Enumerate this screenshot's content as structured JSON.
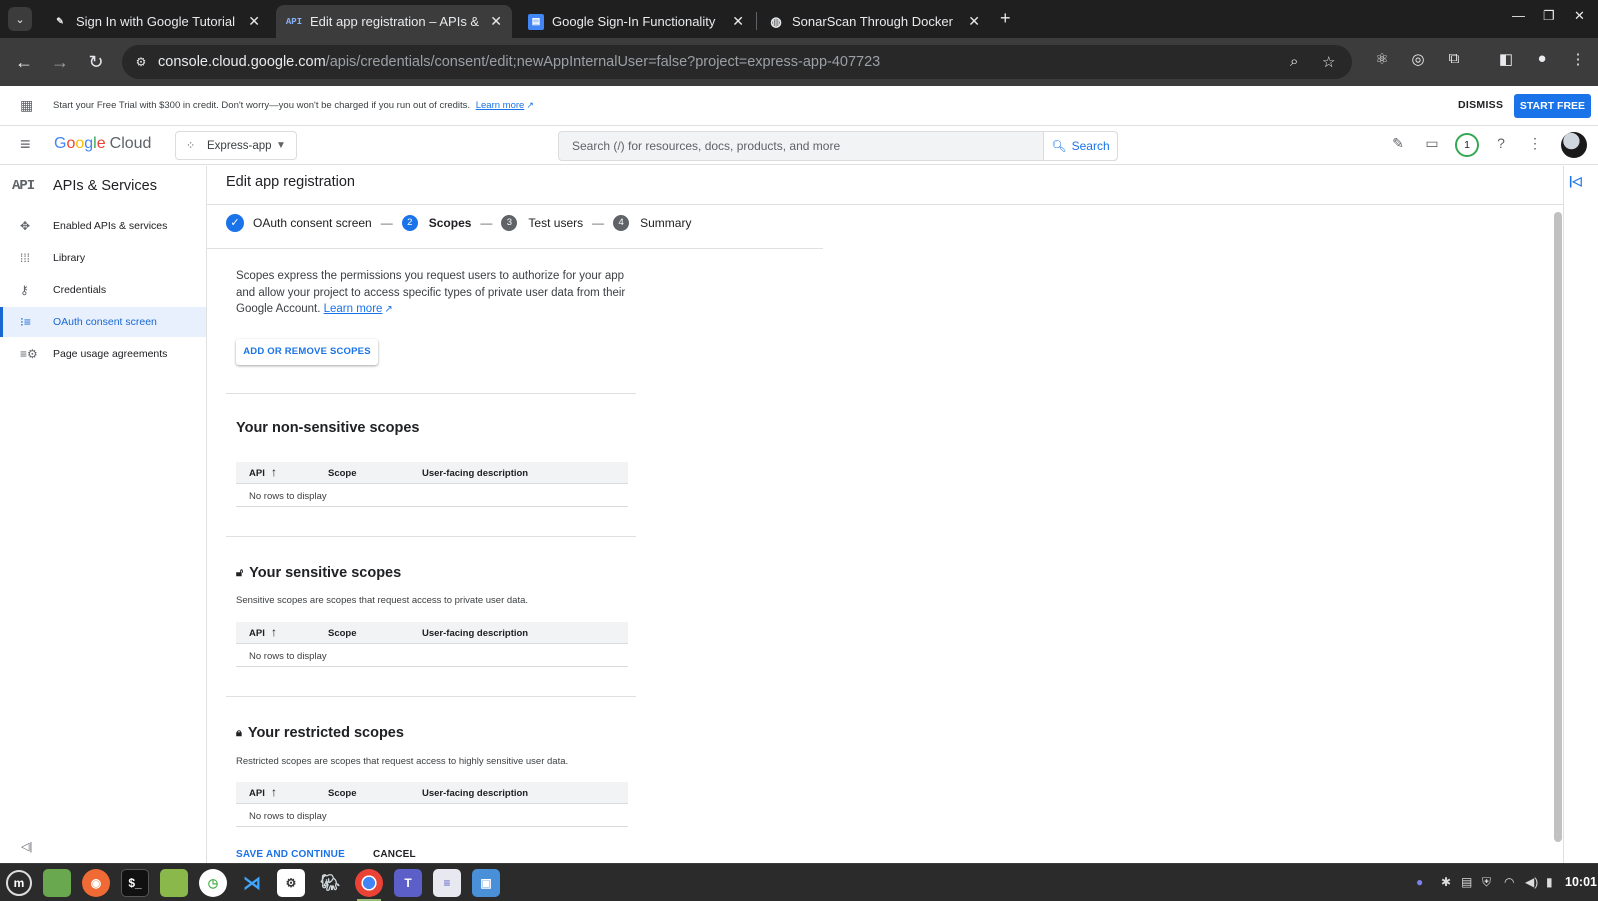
{
  "browser": {
    "tabs": [
      {
        "title": "Sign In with Google Tutorial",
        "active": false,
        "favicon_icon": "drawing-favicon"
      },
      {
        "title": "Edit app registration – APIs &",
        "active": true,
        "favicon_icon": "api-favicon"
      },
      {
        "title": "Google Sign-In Functionality",
        "active": false,
        "favicon_icon": "docs-favicon"
      },
      {
        "title": "SonarScan Through Docker",
        "active": false,
        "favicon_icon": "globe-favicon"
      }
    ],
    "url_host": "console.cloud.google.com",
    "url_path": "/apis/credentials/consent/edit;newAppInternalUser=false?project=express-app-407723"
  },
  "banner": {
    "text": "Start your Free Trial with $300 in credit. Don't worry—you won't be charged if you run out of credits.",
    "link": "Learn more",
    "dismiss": "DISMISS",
    "start_free": "START FREE"
  },
  "header": {
    "logo_google": "Google",
    "logo_cloud": "Cloud",
    "project": "Express-app",
    "search_placeholder": "Search (/) for resources, docs, products, and more",
    "search_button": "Search",
    "notification_count": "1"
  },
  "sidebar": {
    "api_badge": "API",
    "title": "APIs & Services",
    "items": [
      {
        "label": "Enabled APIs & services",
        "icon": "hub-icon",
        "active": false
      },
      {
        "label": "Library",
        "icon": "library-grid-icon",
        "active": false
      },
      {
        "label": "Credentials",
        "icon": "key-icon",
        "active": false
      },
      {
        "label": "OAuth consent screen",
        "icon": "consent-list-icon",
        "active": true
      },
      {
        "label": "Page usage agreements",
        "icon": "settings-list-icon",
        "active": false
      }
    ]
  },
  "main": {
    "title": "Edit app registration",
    "steps": [
      {
        "label": "OAuth consent screen",
        "number": "",
        "state": "done"
      },
      {
        "label": "Scopes",
        "number": "2",
        "state": "current"
      },
      {
        "label": "Test users",
        "number": "3",
        "state": "todo"
      },
      {
        "label": "Summary",
        "number": "4",
        "state": "todo"
      }
    ],
    "intro": "Scopes express the permissions you request users to authorize for your app and allow your project to access specific types of private user data from their Google Account.",
    "intro_link": "Learn more",
    "add_scopes_button": "ADD OR REMOVE SCOPES",
    "table_headers": {
      "api": "API",
      "scope": "Scope",
      "description": "User-facing description"
    },
    "empty_text": "No rows to display",
    "sections": [
      {
        "title": "Your non-sensitive scopes",
        "description": "",
        "icon": ""
      },
      {
        "title": "Your sensitive scopes",
        "description": "Sensitive scopes are scopes that request access to private user data.",
        "icon": "lock-open-icon"
      },
      {
        "title": "Your restricted scopes",
        "description": "Restricted scopes are scopes that request access to highly sensitive user data.",
        "icon": "lock-icon"
      }
    ],
    "save_button": "SAVE AND CONTINUE",
    "cancel_button": "CANCEL"
  },
  "taskbar": {
    "clock": "10:01"
  },
  "colors": {
    "accent": "#1a73e8",
    "active_nav_bg": "#e8f0fe",
    "chrome_dark": "#1f1f1f",
    "notif_ring": "#34a853"
  }
}
